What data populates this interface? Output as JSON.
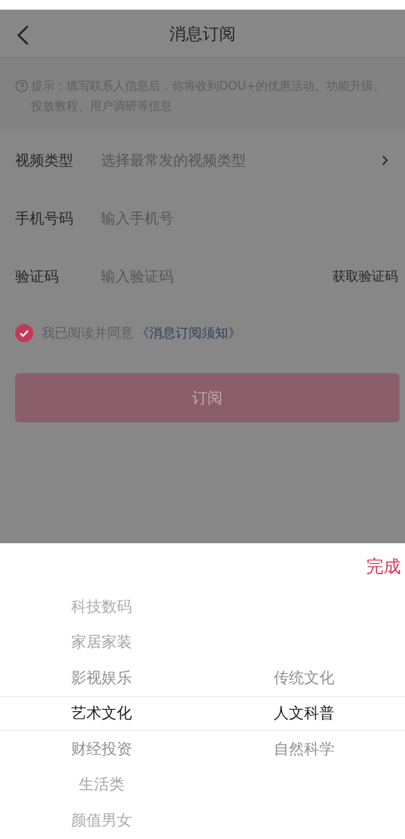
{
  "header": {
    "title": "消息订阅"
  },
  "hint": "提示：填写联系人信息后，你将收到DOU+的优惠活动、功能升级、投放教程、用户调研等信息",
  "fields": [
    {
      "kind": "select",
      "label": "视频类型",
      "placeholder": "选择最常发的视频类型"
    },
    {
      "kind": "input",
      "label": "手机号码",
      "placeholder": "输入手机号"
    },
    {
      "kind": "code",
      "label": "验证码",
      "placeholder": "输入验证码",
      "action": "获取验证码"
    }
  ],
  "agreement": {
    "checked": true,
    "text": "我已阅读并同意",
    "link": "《消息订阅须知》"
  },
  "submit": {
    "label": "订阅",
    "disabled": true
  },
  "picker": {
    "done": "完成",
    "columns": [
      [
        {
          "label": "科技数码",
          "selected": false
        },
        {
          "label": "家居家装",
          "selected": false
        },
        {
          "label": "影视娱乐",
          "selected": false
        },
        {
          "label": "艺术文化",
          "selected": true
        },
        {
          "label": "财经投资",
          "selected": false
        },
        {
          "label": "生活类",
          "selected": false
        },
        {
          "label": "颜值男女",
          "selected": false
        }
      ],
      [
        {
          "label": "传统文化",
          "selected": false
        },
        {
          "label": "人文科普",
          "selected": true
        },
        {
          "label": "自然科学",
          "selected": false
        }
      ]
    ]
  }
}
